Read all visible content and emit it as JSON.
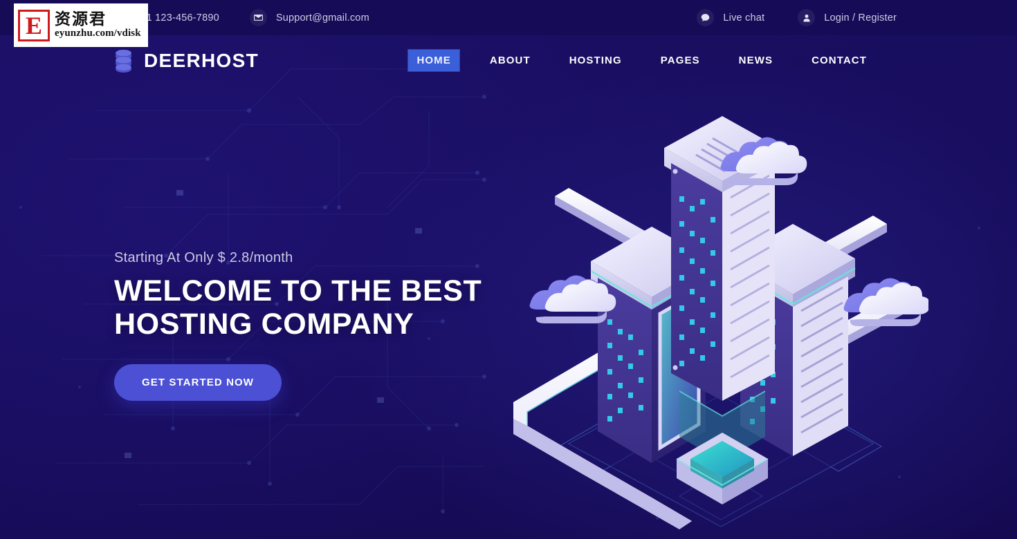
{
  "site": {
    "brand_name": "DEERHOST",
    "brand_icon": "database-stack-icon"
  },
  "topbar": {
    "phone": "+1 123-456-7890",
    "phone_icon": "phone-icon",
    "email": "Support@gmail.com",
    "email_icon": "envelope-icon",
    "live_chat": "Live chat",
    "live_chat_icon": "chat-bubble-icon",
    "account": "Login / Register",
    "account_icon": "user-icon"
  },
  "nav": {
    "items": [
      {
        "label": "HOME",
        "selected": true
      },
      {
        "label": "ABOUT",
        "selected": false
      },
      {
        "label": "HOSTING",
        "selected": false
      },
      {
        "label": "PAGES",
        "selected": false
      },
      {
        "label": "NEWS",
        "selected": false
      },
      {
        "label": "CONTACT",
        "selected": false
      }
    ]
  },
  "hero": {
    "eyebrow": "Starting At Only $ 2.8/month",
    "title_line1": "WELCOME TO THE BEST",
    "title_line2": "HOSTING COMPANY",
    "cta_label": "GET STARTED NOW",
    "illustration": "isometric-datacenter-servers-clouds"
  },
  "watermark": {
    "logo_letter": "E",
    "chinese": "资源君",
    "url": "eyunzhu.com/vdisk"
  },
  "colors": {
    "page_background": "#180d61",
    "topbar_background": "#150b57",
    "accent_button": "#4b50d4",
    "nav_selected": "#3a5fd8",
    "text_primary": "#ffffff",
    "text_muted": "#cfcde6",
    "illustration_cyan": "#2ad9d0",
    "illustration_purple": "#6a5fd6"
  }
}
